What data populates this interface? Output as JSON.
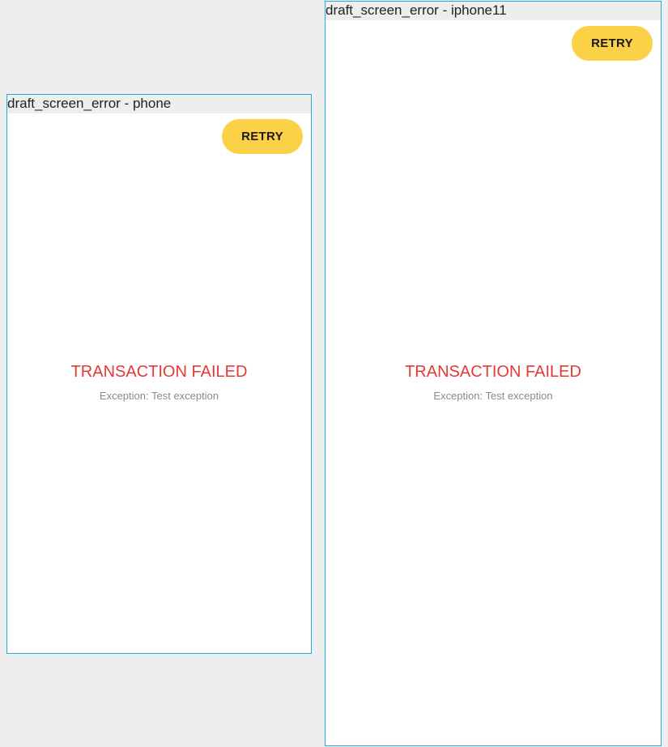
{
  "previews": [
    {
      "label": "draft_screen_error - phone",
      "retry_label": "RETRY",
      "error_title": "TRANSACTION FAILED",
      "error_message": "Exception: Test exception"
    },
    {
      "label": "draft_screen_error - iphone11",
      "retry_label": "RETRY",
      "error_title": "TRANSACTION FAILED",
      "error_message": "Exception: Test exception"
    }
  ],
  "colors": {
    "canvas_background": "#eeeeee",
    "frame_border": "#29a8e0",
    "retry_button": "#fad147",
    "error_title": "#e53935",
    "error_message": "#8a8a8a"
  }
}
